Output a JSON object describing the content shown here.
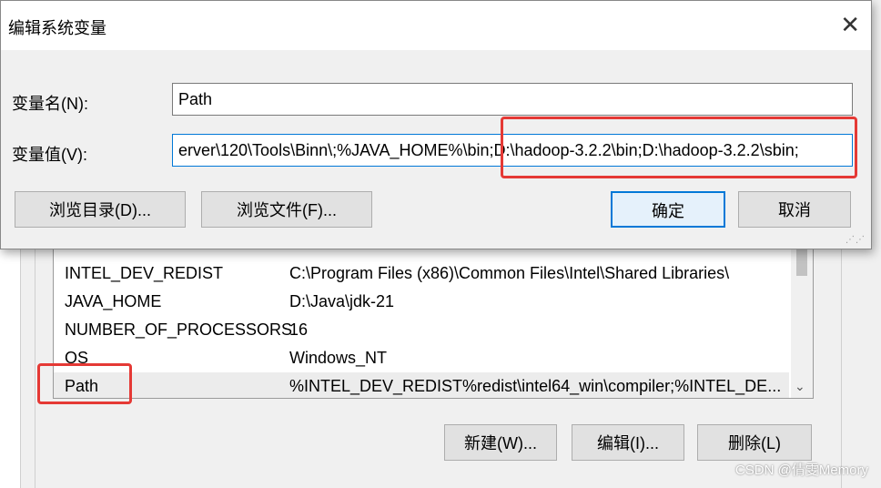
{
  "dialog": {
    "title": "编辑系统变量",
    "close_glyph": "✕",
    "name_label": "变量名(N):",
    "value_label": "变量值(V):",
    "name_value": "Path",
    "value_value": "erver\\120\\Tools\\Binn\\;%JAVA_HOME%\\bin;D:\\hadoop-3.2.2\\bin;D:\\hadoop-3.2.2\\sbin;",
    "browse_dir_label": "浏览目录(D)...",
    "browse_file_label": "浏览文件(F)...",
    "ok_label": "确定",
    "cancel_label": "取消"
  },
  "variables": {
    "rows": [
      {
        "name": "INTEL_DEV_REDIST",
        "value": "C:\\Program Files (x86)\\Common Files\\Intel\\Shared Libraries\\"
      },
      {
        "name": "JAVA_HOME",
        "value": "D:\\Java\\jdk-21"
      },
      {
        "name": "NUMBER_OF_PROCESSORS",
        "value": "16"
      },
      {
        "name": "OS",
        "value": "Windows_NT"
      },
      {
        "name": "Path",
        "value": "%INTEL_DEV_REDIST%redist\\intel64_win\\compiler;%INTEL_DE..."
      }
    ],
    "new_label": "新建(W)...",
    "edit_label": "编辑(I)...",
    "delete_label": "删除(L)"
  },
  "highlight_color": "#e53935",
  "watermark": "CSDN @倩雯Memory"
}
